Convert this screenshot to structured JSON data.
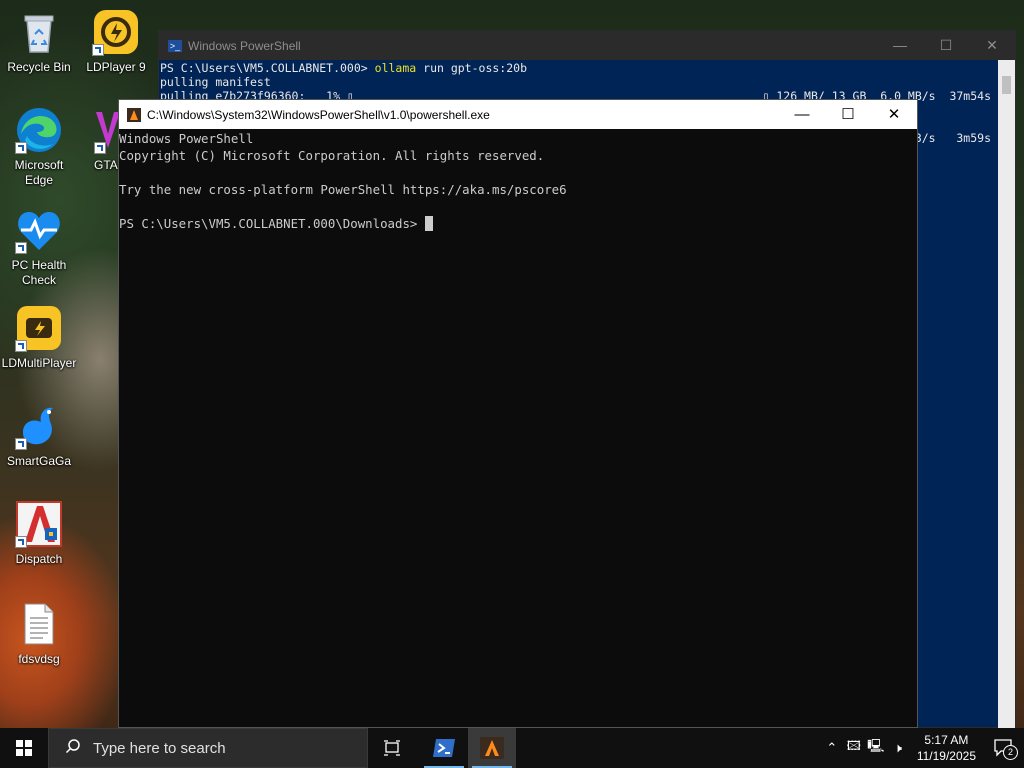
{
  "desktop": {
    "icons": [
      {
        "label": "Recycle Bin"
      },
      {
        "label": "LDPlayer 9"
      },
      {
        "label": "Microsoft Edge"
      },
      {
        "label": "GTA"
      },
      {
        "label": "PC Health Check"
      },
      {
        "label": "LDMultiPlayer"
      },
      {
        "label": "SmartGaGa"
      },
      {
        "label": "Dispatch"
      },
      {
        "label": "fdsvdsg"
      }
    ]
  },
  "back_window": {
    "title": "Windows PowerShell",
    "line1_prompt": "PS C:\\Users\\VM5.COLLABNET.000>",
    "line1_cmd": "ollama",
    "line1_args": "run gpt-oss:20b",
    "line2": "pulling manifest",
    "line3_left": "pulling e7b273f96360:   1% ▯",
    "line3_right": "▯ 126 MB/ 13 GB  6.0 MB/s  37m54s",
    "line4_right": "3/s   3m59s",
    "controls": {
      "minimize": "—",
      "maximize": "☐",
      "close": "✕"
    }
  },
  "front_window": {
    "title": "C:\\Windows\\System32\\WindowsPowerShell\\v1.0\\powershell.exe",
    "lines": [
      "Windows PowerShell",
      "Copyright (C) Microsoft Corporation. All rights reserved.",
      "",
      "Try the new cross-platform PowerShell https://aka.ms/pscore6",
      ""
    ],
    "prompt": "PS C:\\Users\\VM5.COLLABNET.000\\Downloads>",
    "controls": {
      "minimize": "—",
      "maximize": "☐",
      "close": "✕"
    }
  },
  "taskbar": {
    "search_placeholder": "Type here to search",
    "time": "5:17 AM",
    "date": "11/19/2025",
    "notification_count": "2"
  },
  "colors": {
    "back_console_bg": "#012456",
    "front_console_bg": "#0c0c0c",
    "taskbar_bg": "#101010",
    "accent": "#76b9ed"
  }
}
